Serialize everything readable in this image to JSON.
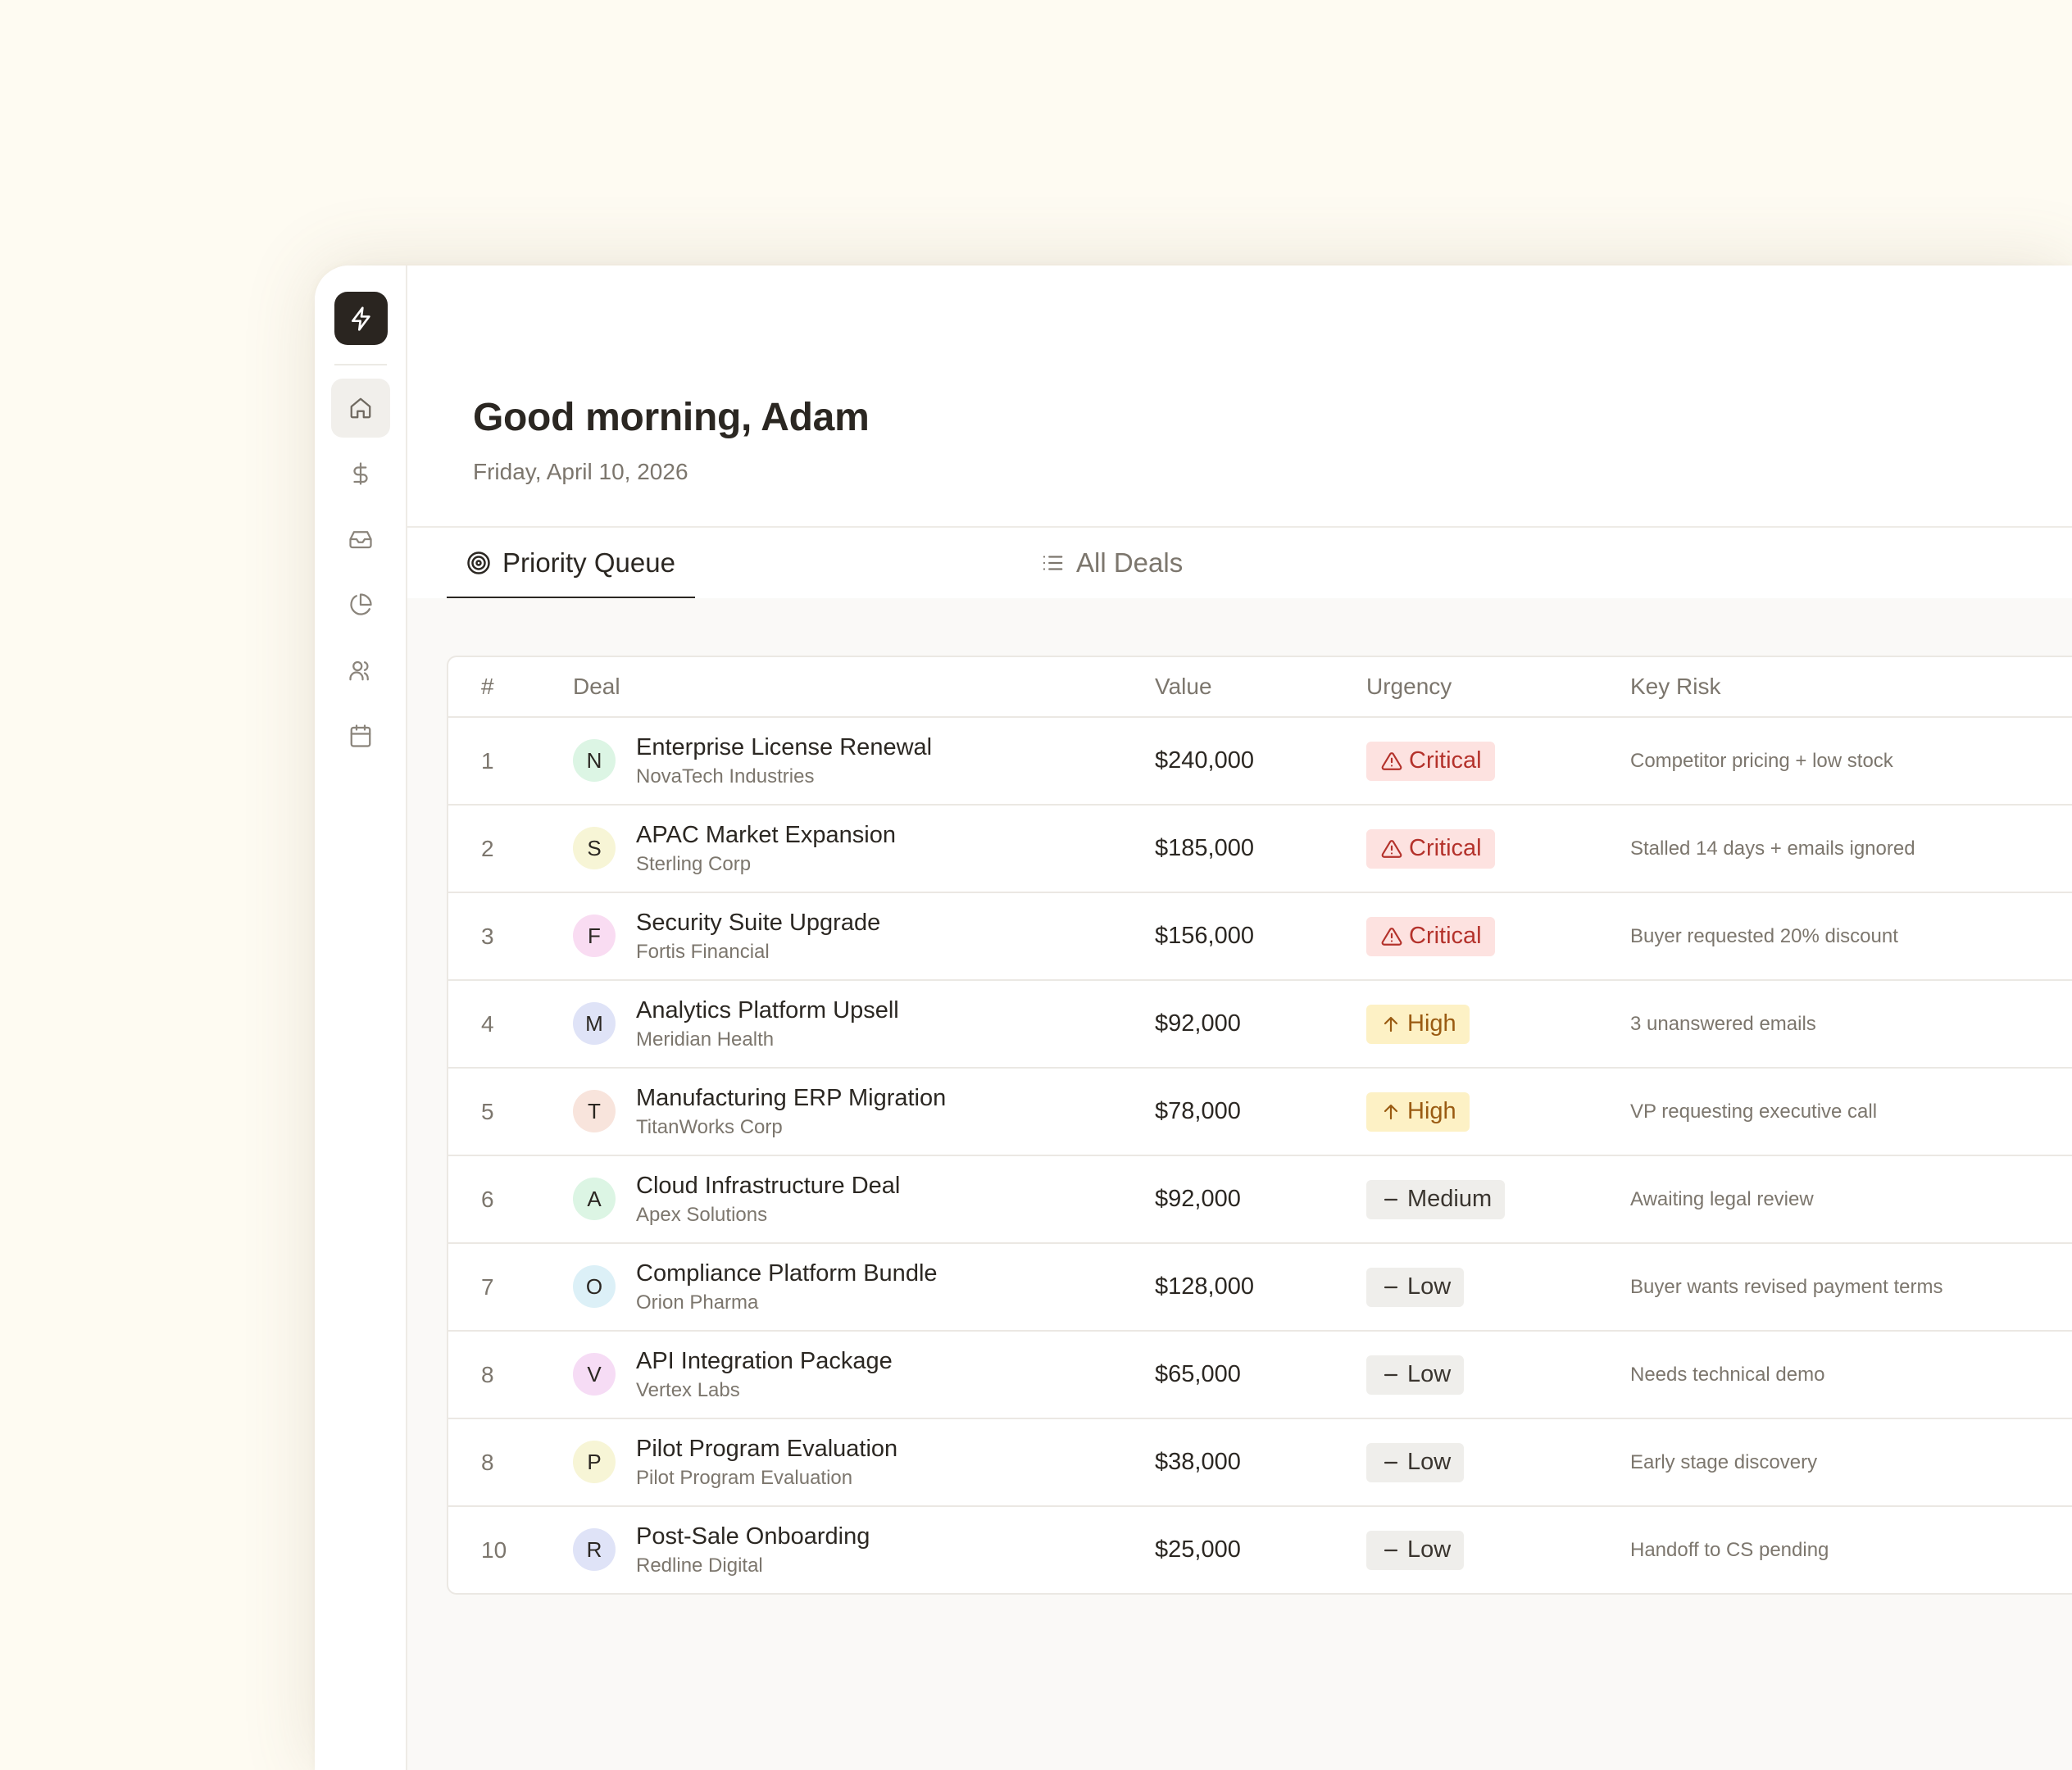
{
  "greeting": "Good morning, Adam",
  "date": "Friday, April 10, 2026",
  "sidebar": {
    "logo_icon": "lightning-icon",
    "items": [
      {
        "icon": "home-icon",
        "active": true
      },
      {
        "icon": "dollar-icon",
        "active": false
      },
      {
        "icon": "inbox-icon",
        "active": false
      },
      {
        "icon": "pie-chart-icon",
        "active": false
      },
      {
        "icon": "users-icon",
        "active": false
      },
      {
        "icon": "calendar-icon",
        "active": false
      }
    ]
  },
  "tabs": [
    {
      "label": "Priority Queue",
      "icon": "target-icon",
      "active": true
    },
    {
      "label": "All Deals",
      "icon": "list-icon",
      "active": false
    }
  ],
  "table": {
    "headers": {
      "num": "#",
      "deal": "Deal",
      "value": "Value",
      "urgency": "Urgency",
      "risk": "Key Risk"
    },
    "rows": [
      {
        "num": "1",
        "initial": "N",
        "avatar_color": "#dcf5e4",
        "name": "Enterprise License Renewal",
        "company": "NovaTech Industries",
        "value": "$240,000",
        "urgency": "Critical",
        "level": "critical",
        "risk": "Competitor pricing + low stock"
      },
      {
        "num": "2",
        "initial": "S",
        "avatar_color": "#f7f5d6",
        "name": "APAC Market Expansion",
        "company": "Sterling Corp",
        "value": "$185,000",
        "urgency": "Critical",
        "level": "critical",
        "risk": "Stalled 14 days + emails ignored"
      },
      {
        "num": "3",
        "initial": "F",
        "avatar_color": "#f9dcf2",
        "name": "Security Suite Upgrade",
        "company": "Fortis Financial",
        "value": "$156,000",
        "urgency": "Critical",
        "level": "critical",
        "risk": "Buyer requested 20% discount"
      },
      {
        "num": "4",
        "initial": "M",
        "avatar_color": "#dfe3f7",
        "name": "Analytics Platform Upsell",
        "company": "Meridian Health",
        "value": "$92,000",
        "urgency": "High",
        "level": "high",
        "risk": "3 unanswered emails"
      },
      {
        "num": "5",
        "initial": "T",
        "avatar_color": "#f8e4dc",
        "name": "Manufacturing ERP Migration",
        "company": "TitanWorks Corp",
        "value": "$78,000",
        "urgency": "High",
        "level": "high",
        "risk": "VP requesting executive call"
      },
      {
        "num": "6",
        "initial": "A",
        "avatar_color": "#dcf5e4",
        "name": "Cloud Infrastructure Deal",
        "company": "Apex Solutions",
        "value": "$92,000",
        "urgency": "Medium",
        "level": "medium",
        "risk": "Awaiting legal review"
      },
      {
        "num": "7",
        "initial": "O",
        "avatar_color": "#dcf0f7",
        "name": "Compliance Platform Bundle",
        "company": "Orion Pharma",
        "value": "$128,000",
        "urgency": "Low",
        "level": "low",
        "risk": "Buyer wants revised payment terms"
      },
      {
        "num": "8",
        "initial": "V",
        "avatar_color": "#f6dcf5",
        "name": "API Integration Package",
        "company": "Vertex Labs",
        "value": "$65,000",
        "urgency": "Low",
        "level": "low",
        "risk": "Needs technical demo"
      },
      {
        "num": "8",
        "initial": "P",
        "avatar_color": "#f7f5d6",
        "name": "Pilot Program Evaluation",
        "company": "Pilot Program Evaluation",
        "value": "$38,000",
        "urgency": "Low",
        "level": "low",
        "risk": "Early stage discovery"
      },
      {
        "num": "10",
        "initial": "R",
        "avatar_color": "#dfe3f7",
        "name": "Post-Sale Onboarding",
        "company": "Redline Digital",
        "value": "$25,000",
        "urgency": "Low",
        "level": "low",
        "risk": "Handoff to CS pending"
      }
    ]
  }
}
